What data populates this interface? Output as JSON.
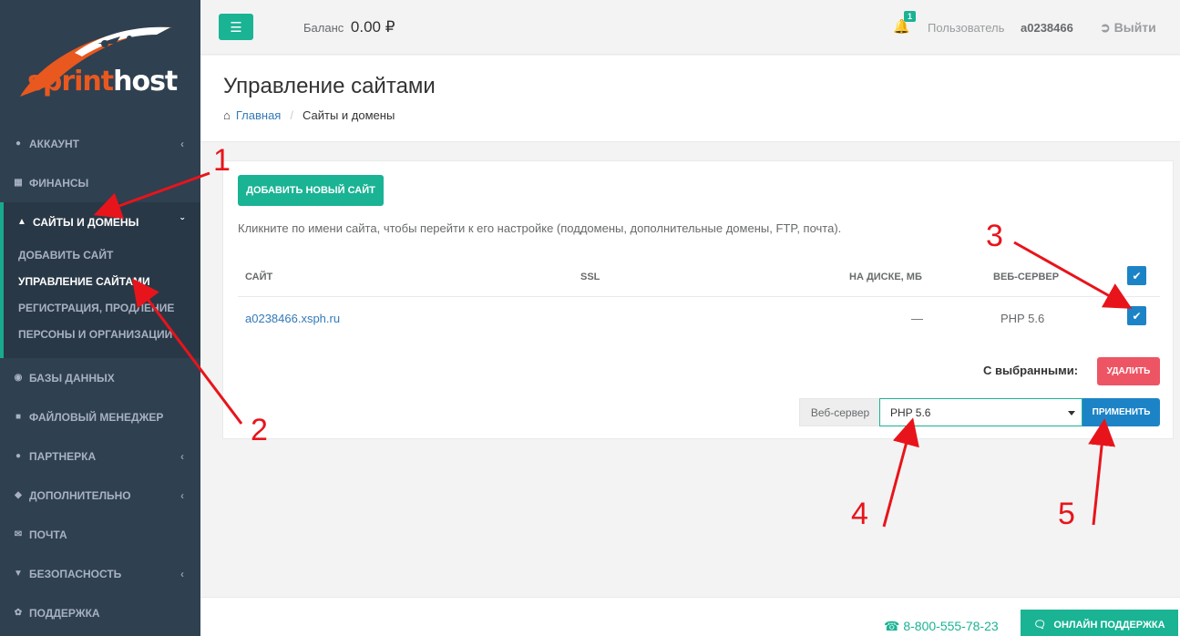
{
  "brand": {
    "logo_part1": "sprint",
    "logo_part2": "host",
    "accent": "#1ab394",
    "sidebar_bg": "#2f4050"
  },
  "topbar": {
    "menu_icon": "bars-icon",
    "balance_label": "Баланс",
    "balance_value": "0.00 ₽",
    "notifications_count": "1",
    "user_label": "Пользователь",
    "user_name": "a0238466",
    "logout_label": "Выйти"
  },
  "sidebar": {
    "items": [
      {
        "label": "Аккаунт",
        "icon": "user-icon"
      },
      {
        "label": "Финансы",
        "icon": "calculator-icon"
      },
      {
        "label": "Сайты и домены",
        "icon": "sitemap-icon"
      },
      {
        "label": "Базы данных",
        "icon": "database-icon"
      },
      {
        "label": "Файловый менеджер",
        "icon": "folder-icon"
      },
      {
        "label": "Партнерка",
        "icon": "users-icon"
      },
      {
        "label": "Дополнительно",
        "icon": "cubes-icon"
      },
      {
        "label": "Почта",
        "icon": "envelope-icon"
      },
      {
        "label": "Безопасность",
        "icon": "shield-icon"
      },
      {
        "label": "Поддержка",
        "icon": "leaf-icon"
      }
    ],
    "subitems": [
      {
        "label": "Добавить сайт"
      },
      {
        "label": "Управление сайтами"
      },
      {
        "label": "Регистрация, продление"
      },
      {
        "label": "Персоны и организации"
      }
    ]
  },
  "page": {
    "title": "Управление сайтами",
    "breadcrumb_home": "Главная",
    "breadcrumb_current": "Сайты и домены"
  },
  "panel": {
    "add_button": "Добавить новый сайт",
    "hint": "Кликните по имени сайта, чтобы перейти к его настройке (поддомены, дополнительные домены, FTP, почта).",
    "columns": [
      "Сайт",
      "SSL",
      "На диске, МБ",
      "Веб-сервер"
    ],
    "rows": [
      {
        "site": "a0238466.xsph.ru",
        "ssl": "",
        "disk": "—",
        "server": "PHP 5.6",
        "checked": true
      }
    ],
    "header_checked": true,
    "selected_label": "С выбранными:",
    "delete_button": "Удалить",
    "webserver_label": "Веб-сервер",
    "webserver_value": "PHP 5.6",
    "apply_button": "Применить"
  },
  "footer": {
    "phone": "8-800-555-78-23",
    "support_button": "Онлайн поддержка"
  },
  "annotations": [
    "1",
    "2",
    "3",
    "4",
    "5"
  ]
}
